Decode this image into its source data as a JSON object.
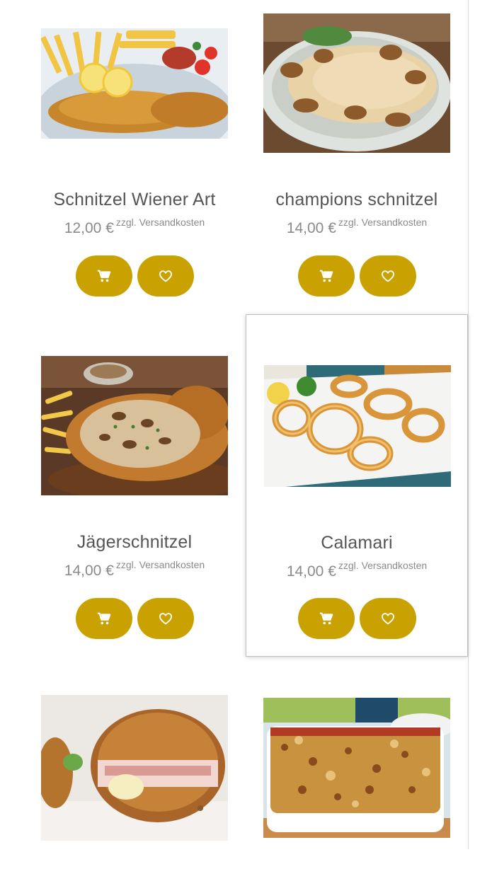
{
  "products": [
    {
      "title": "Schnitzel Wiener Art",
      "price": "12,00 €",
      "shipping": "zzgl. Versandkosten",
      "image": "schnitzel-fries-lemon-photo"
    },
    {
      "title": "champions schnitzel",
      "price": "14,00 €",
      "shipping": "zzgl. Versandkosten",
      "image": "chicken-mushroom-sauce-photo"
    },
    {
      "title": "Jägerschnitzel",
      "price": "14,00 €",
      "shipping": "zzgl. Versandkosten",
      "image": "jaegerschnitzel-photo"
    },
    {
      "title": "Calamari",
      "price": "14,00 €",
      "shipping": "zzgl. Versandkosten",
      "image": "fried-calamari-rings-photo"
    },
    {
      "image": "cordon-bleu-photo"
    },
    {
      "image": "lasagne-casserole-photo"
    }
  ],
  "icons": {
    "cart": "cart-icon",
    "wishlist": "heart-icon"
  },
  "colors": {
    "button": "#c9a100",
    "title": "#555555",
    "price": "#8a8a8a",
    "divider": "#dcdcdc"
  }
}
